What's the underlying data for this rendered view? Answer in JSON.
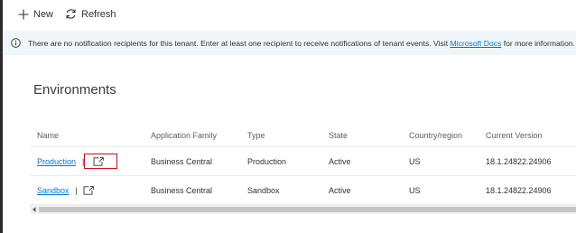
{
  "toolbar": {
    "new_label": "New",
    "refresh_label": "Refresh"
  },
  "banner": {
    "text_before": "There are no notification recipients for this tenant. Enter at least one recipient to receive notifications of tenant events. Visit ",
    "link_text": "Microsoft Docs",
    "text_after": " for more information."
  },
  "section": {
    "title": "Environments"
  },
  "table": {
    "headers": {
      "name": "Name",
      "family": "Application Family",
      "type": "Type",
      "state": "State",
      "country": "Country/region",
      "version": "Current Version"
    },
    "separator": "|",
    "rows": [
      {
        "name": "Production",
        "family": "Business Central",
        "type": "Production",
        "state": "Active",
        "country": "US",
        "version": "18.1.24822.24906"
      },
      {
        "name": "Sandbox",
        "family": "Business Central",
        "type": "Sandbox",
        "state": "Active",
        "country": "US",
        "version": "18.1.24822.24906"
      }
    ]
  },
  "colors": {
    "accent": "#0078d4",
    "banner_bg": "#eff6fc",
    "highlight_border": "#c50f1f"
  }
}
